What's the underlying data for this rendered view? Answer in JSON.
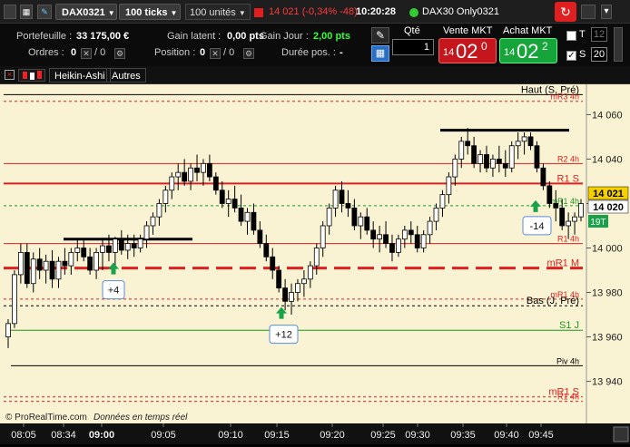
{
  "topbar": {
    "instrument": "DAX0321",
    "ticks": "100 ticks",
    "units": "100 unités",
    "quote": "14 021 (-0,34% -48)",
    "time": "10:20:28",
    "feed": "DAX30 Only0321"
  },
  "account": {
    "portfolio_label": "Portefeuille :",
    "portfolio_value": "33 175,00 €",
    "unrealized_label": "Gain latent :",
    "unrealized_value": "0,00 pts",
    "daygain_label": "Gain Jour :",
    "daygain_value": "2,00 pts",
    "orders_label": "Ordres :",
    "orders_value": "0",
    "orders_sep": "/ 0",
    "position_label": "Position :",
    "position_value": "0",
    "position_sep": "/ 0",
    "duration_label": "Durée pos. :",
    "duration_value": "-"
  },
  "order": {
    "qty_label": "Qté",
    "qty_value": "1",
    "sell_label": "Vente MKT",
    "sell_small": "14",
    "sell_big": "02",
    "sell_sup": "0",
    "buy_label": "Achat MKT",
    "buy_small": "14",
    "buy_big": "02",
    "buy_sup": "2",
    "t_label": "T",
    "t_value": "12",
    "s_label": "S",
    "s_value": "20"
  },
  "chartbar": {
    "style": "Heikin-Ashi",
    "others": "Autres"
  },
  "chart": {
    "footer_brand": "© ProRealTime.com",
    "footer_text": "Données en temps réel",
    "last_price_main": "14 021",
    "last_price_second": "14 020",
    "candle_count": "19T",
    "colors": {
      "bg": "#f9f3d4",
      "bull": "#ffffff",
      "bear": "#000000",
      "red": "#e02020",
      "green": "#1a9a1a"
    }
  },
  "chart_data": {
    "type": "candlestick",
    "x_ticks": [
      "08:05",
      "08:34",
      "09:00",
      "09:05",
      "09:10",
      "09:15",
      "09:20",
      "09:25",
      "09:30",
      "09:35",
      "09:40",
      "09:45"
    ],
    "y_ticks": [
      "14 060",
      "14 040",
      "14 020",
      "14 000",
      "13 980",
      "13 960",
      "13 940"
    ],
    "ylim": [
      13928,
      14072
    ],
    "levels": [
      {
        "name": "Haut (S, Pré)",
        "value": 14069,
        "color": "#000000",
        "style": "solid"
      },
      {
        "name": "mR3 4h",
        "value": 14066,
        "color": "#e02020",
        "style": "dotted"
      },
      {
        "name": "R2 4h",
        "value": 14038,
        "color": "#e02020",
        "style": "solid"
      },
      {
        "name": "R1 S",
        "value": 14029,
        "color": "#e02020",
        "style": "solid-thick"
      },
      {
        "name": "mR1 4h",
        "value": 14019,
        "color": "#1a9a1a",
        "style": "dotted"
      },
      {
        "name": "R1 4h",
        "value": 14002,
        "color": "#e02020",
        "style": "solid"
      },
      {
        "name": "mR1 M",
        "value": 13991,
        "color": "#e02020",
        "style": "dashed"
      },
      {
        "name": "mR1 4h",
        "value": 13977,
        "color": "#e02020",
        "style": "dotted"
      },
      {
        "name": "Bas (J, Pré)",
        "value": 13974,
        "color": "#000000",
        "style": "dotted"
      },
      {
        "name": "S1 J",
        "value": 13963,
        "color": "#1a9a1a",
        "style": "solid"
      },
      {
        "name": "Piv 4h",
        "value": 13947,
        "color": "#000000",
        "style": "solid"
      },
      {
        "name": "mR1 S",
        "value": 13933,
        "color": "#e02020",
        "style": "dotted"
      },
      {
        "name": "R1 4h",
        "value": 13931,
        "color": "#e02020",
        "style": "dotted"
      }
    ],
    "signals": [
      {
        "label": "+4",
        "x": 125,
        "value": 13991
      },
      {
        "label": "+12",
        "x": 310,
        "value": 13971
      },
      {
        "label": "-14",
        "x": 590,
        "value": 14019
      }
    ],
    "candles": [
      [
        13960,
        13968,
        13955,
        13966
      ],
      [
        13966,
        13990,
        13964,
        13988
      ],
      [
        13988,
        14002,
        13984,
        13998
      ],
      [
        13998,
        14002,
        13982,
        13984
      ],
      [
        13984,
        13998,
        13980,
        13995
      ],
      [
        13995,
        14000,
        13986,
        13990
      ],
      [
        13990,
        13997,
        13984,
        13994
      ],
      [
        13994,
        13999,
        13982,
        13986
      ],
      [
        13986,
        13996,
        13982,
        13994
      ],
      [
        13994,
        14000,
        13988,
        13992
      ],
      [
        13992,
        14000,
        13988,
        13998
      ],
      [
        13998,
        14004,
        13994,
        14000
      ],
      [
        14000,
        14004,
        13994,
        13996
      ],
      [
        13996,
        14000,
        13988,
        13990
      ],
      [
        13990,
        14000,
        13986,
        13998
      ],
      [
        13998,
        14004,
        13990,
        14001
      ],
      [
        14001,
        14006,
        13994,
        13998
      ],
      [
        13998,
        14005,
        13992,
        14004
      ],
      [
        14004,
        14008,
        13997,
        13999
      ],
      [
        13999,
        14006,
        13995,
        14002
      ],
      [
        14002,
        14006,
        13996,
        14000
      ],
      [
        14000,
        14006,
        13998,
        14004
      ],
      [
        14004,
        14012,
        14000,
        14010
      ],
      [
        14010,
        14016,
        14006,
        14014
      ],
      [
        14014,
        14022,
        14010,
        14020
      ],
      [
        14020,
        14028,
        14016,
        14026
      ],
      [
        14026,
        14034,
        14022,
        14032
      ],
      [
        14032,
        14038,
        14026,
        14034
      ],
      [
        14034,
        14040,
        14028,
        14030
      ],
      [
        14030,
        14038,
        14026,
        14036
      ],
      [
        14036,
        14042,
        14030,
        14034
      ],
      [
        14034,
        14040,
        14028,
        14038
      ],
      [
        14038,
        14042,
        14030,
        14032
      ],
      [
        14032,
        14034,
        14024,
        14026
      ],
      [
        14026,
        14030,
        14018,
        14020
      ],
      [
        14020,
        14026,
        14014,
        14022
      ],
      [
        14022,
        14028,
        14016,
        14018
      ],
      [
        14018,
        14024,
        14010,
        14012
      ],
      [
        14012,
        14018,
        14006,
        14016
      ],
      [
        14016,
        14020,
        14006,
        14008
      ],
      [
        14008,
        14012,
        14000,
        14002
      ],
      [
        14002,
        14006,
        13994,
        13996
      ],
      [
        13996,
        14000,
        13986,
        13990
      ],
      [
        13990,
        13992,
        13980,
        13982
      ],
      [
        13982,
        13986,
        13972,
        13976
      ],
      [
        13976,
        13984,
        13970,
        13980
      ],
      [
        13980,
        13986,
        13976,
        13984
      ],
      [
        13984,
        13990,
        13978,
        13986
      ],
      [
        13986,
        13994,
        13982,
        13992
      ],
      [
        13992,
        14002,
        13988,
        14000
      ],
      [
        14000,
        14012,
        13996,
        14010
      ],
      [
        14010,
        14020,
        14006,
        14018
      ],
      [
        14018,
        14028,
        14014,
        14026
      ],
      [
        14026,
        14030,
        14016,
        14020
      ],
      [
        14020,
        14026,
        14014,
        14018
      ],
      [
        14018,
        14022,
        14008,
        14010
      ],
      [
        14010,
        14016,
        14004,
        14014
      ],
      [
        14014,
        14018,
        14006,
        14008
      ],
      [
        14008,
        14012,
        14000,
        14004
      ],
      [
        14004,
        14010,
        13998,
        14006
      ],
      [
        14006,
        14012,
        14000,
        14002
      ],
      [
        14002,
        14006,
        13994,
        13998
      ],
      [
        13998,
        14006,
        13996,
        14004
      ],
      [
        14004,
        14010,
        14000,
        14008
      ],
      [
        14008,
        14012,
        14002,
        14006
      ],
      [
        14006,
        14010,
        13998,
        14000
      ],
      [
        14000,
        14008,
        13998,
        14006
      ],
      [
        14006,
        14014,
        14002,
        14012
      ],
      [
        14012,
        14020,
        14008,
        14018
      ],
      [
        14018,
        14026,
        14014,
        14024
      ],
      [
        14024,
        14034,
        14020,
        14032
      ],
      [
        14032,
        14042,
        14028,
        14040
      ],
      [
        14040,
        14050,
        14036,
        14048
      ],
      [
        14048,
        14054,
        14042,
        14046
      ],
      [
        14046,
        14050,
        14036,
        14038
      ],
      [
        14038,
        14044,
        14034,
        14042
      ],
      [
        14042,
        14046,
        14034,
        14036
      ],
      [
        14036,
        14042,
        14032,
        14040
      ],
      [
        14040,
        14046,
        14034,
        14038
      ],
      [
        14038,
        14044,
        14032,
        14036
      ],
      [
        14036,
        14048,
        14034,
        14046
      ],
      [
        14046,
        14052,
        14040,
        14048
      ],
      [
        14048,
        14052,
        14042,
        14050
      ],
      [
        14050,
        14052,
        14044,
        14046
      ],
      [
        14046,
        14048,
        14034,
        14036
      ],
      [
        14036,
        14038,
        14026,
        14028
      ],
      [
        14028,
        14030,
        14018,
        14020
      ],
      [
        14020,
        14026,
        14012,
        14018
      ],
      [
        14018,
        14022,
        14008,
        14010
      ],
      [
        14010,
        14016,
        14004,
        14012
      ],
      [
        14012,
        14016,
        14006,
        14014
      ],
      [
        14014,
        14022,
        14012,
        14020
      ]
    ]
  }
}
